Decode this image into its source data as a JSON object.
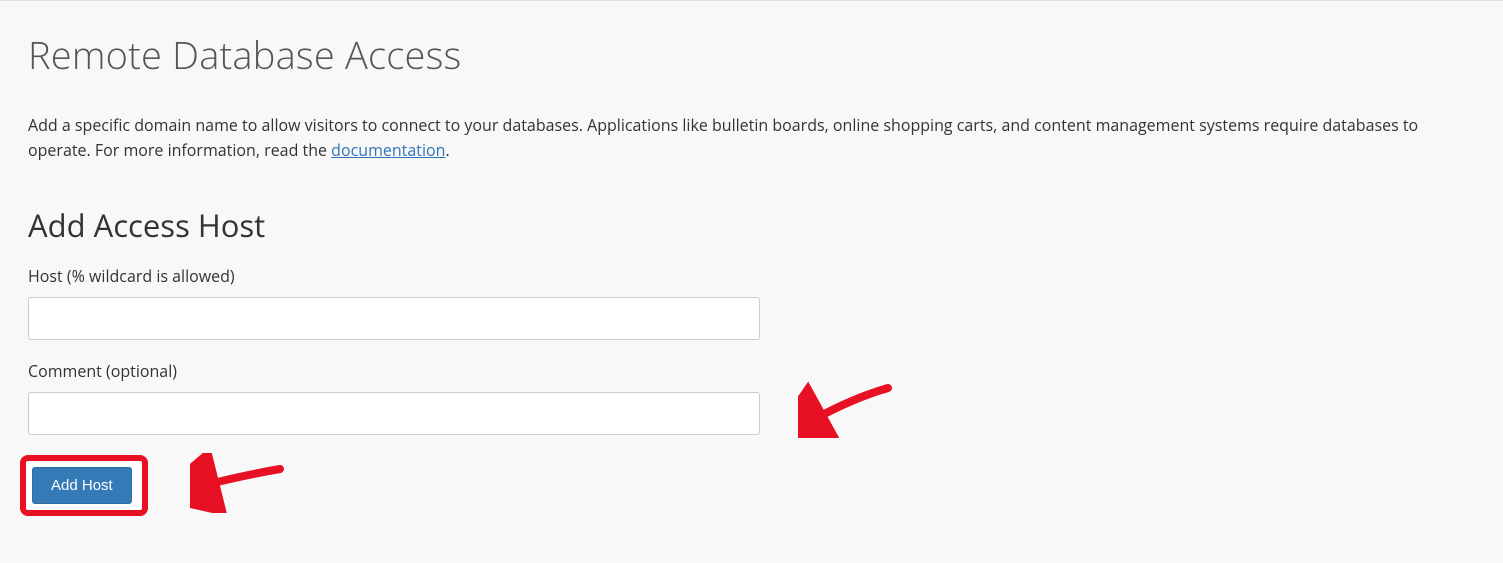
{
  "page": {
    "title": "Remote Database Access",
    "description_part1": "Add a specific domain name to allow visitors to connect to your databases. Applications like bulletin boards, online shopping carts, and content management systems require databases to operate. For more information, read the ",
    "doc_link_text": "documentation",
    "description_part2": "."
  },
  "form": {
    "heading": "Add Access Host",
    "host_label": "Host (% wildcard is allowed)",
    "host_value": "",
    "comment_label": "Comment (optional)",
    "comment_value": "",
    "submit_label": "Add Host"
  }
}
